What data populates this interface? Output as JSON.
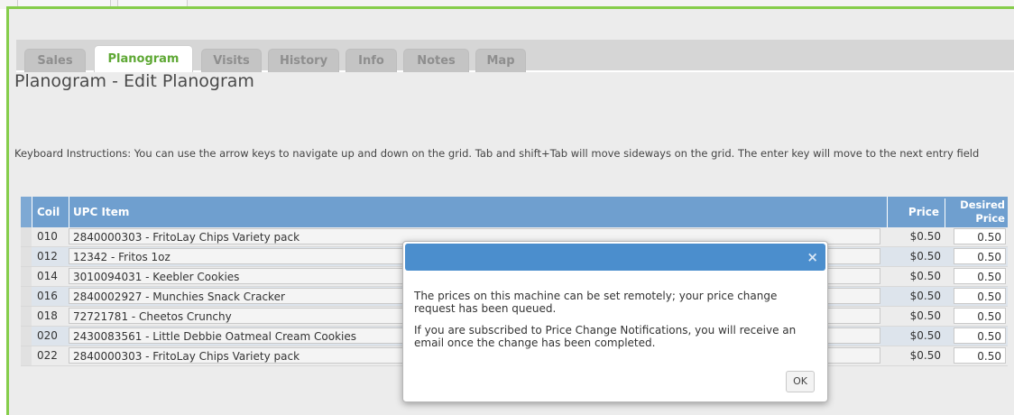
{
  "tabs": [
    {
      "label": "Sales",
      "active": false
    },
    {
      "label": "Planogram",
      "active": true
    },
    {
      "label": "Visits",
      "active": false
    },
    {
      "label": "History",
      "active": false
    },
    {
      "label": "Info",
      "active": false
    },
    {
      "label": "Notes",
      "active": false
    },
    {
      "label": "Map",
      "active": false
    }
  ],
  "page_title": "Planogram - Edit Planogram",
  "instructions": "Keyboard Instructions: You can use the arrow keys to navigate up and down on the grid. Tab and shift+Tab will move sideways on the grid. The enter key will move to the next entry field",
  "grid": {
    "headers": {
      "coil": "Coil",
      "upc": "UPC Item",
      "price": "Price",
      "desired_line1": "Desired",
      "desired_line2": "Price"
    },
    "rows": [
      {
        "coil": "010",
        "upc": "2840000303 - FritoLay Chips Variety pack",
        "price": "$0.50",
        "desired": "0.50"
      },
      {
        "coil": "012",
        "upc": "12342 - Fritos 1oz",
        "price": "$0.50",
        "desired": "0.50"
      },
      {
        "coil": "014",
        "upc": "3010094031 - Keebler Cookies",
        "price": "$0.50",
        "desired": "0.50"
      },
      {
        "coil": "016",
        "upc": "2840002927 - Munchies Snack Cracker",
        "price": "$0.50",
        "desired": "0.50"
      },
      {
        "coil": "018",
        "upc": "72721781 - Cheetos Crunchy",
        "price": "$0.50",
        "desired": "0.50"
      },
      {
        "coil": "020",
        "upc": "2430083561 - Little Debbie Oatmeal Cream Cookies",
        "price": "$0.50",
        "desired": "0.50"
      },
      {
        "coil": "022",
        "upc": "2840000303 - FritoLay Chips Variety pack",
        "price": "$0.50",
        "desired": "0.50"
      }
    ]
  },
  "modal": {
    "close_icon": "×",
    "message_1": "The prices on this machine can be set remotely; your price change request has been queued.",
    "message_2": "If you are subscribed to Price Change Notifications, you will receive an email once the change has been completed.",
    "ok_label": "OK"
  },
  "colors": {
    "accent_green": "#5ea834",
    "frame_green": "#86cd4b",
    "grid_header_blue": "#6f9fcf",
    "modal_header_blue": "#4b8ecd"
  }
}
